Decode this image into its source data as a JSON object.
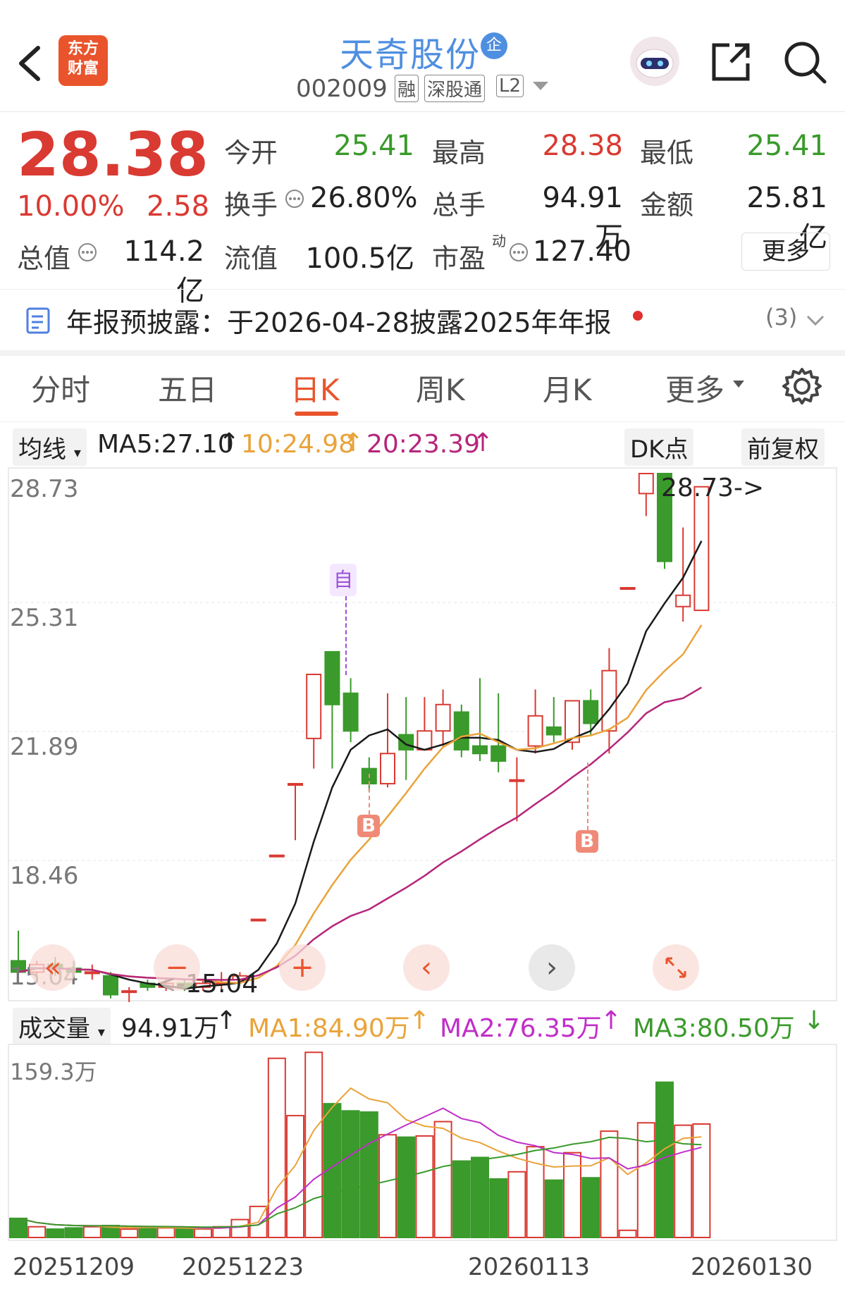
{
  "header": {
    "logo_line1": "东方",
    "logo_line2": "财富",
    "stock_name": "天奇股份",
    "name_badge": "企",
    "stock_code": "002009",
    "tag_margin": "融",
    "tag_connect": "深股通",
    "tag_level": "L2"
  },
  "quote": {
    "price": "28.38",
    "change_pct": "10.00%",
    "change_amt": "2.58",
    "open_label": "今开",
    "open_value": "25.41",
    "high_label": "最高",
    "high_value": "28.38",
    "low_label": "最低",
    "low_value": "25.41",
    "turnover_label": "换手",
    "turnover_value": "26.80%",
    "volume_label": "总手",
    "volume_value": "94.91万",
    "amount_label": "金额",
    "amount_value": "25.81亿",
    "mktcap_label": "总值",
    "mktcap_value": "114.2亿",
    "float_label": "流值",
    "float_value": "100.5亿",
    "pe_label": "市盈",
    "pe_super": "动",
    "pe_value": "127.40",
    "more_button": "更多"
  },
  "notice": {
    "text": "年报预披露：于2026-04-28披露2025年年报",
    "count": "(3)"
  },
  "tabs": [
    "分时",
    "五日",
    "日K",
    "周K",
    "月K",
    "更多"
  ],
  "active_tab": "日K",
  "ma_bar": {
    "selector": "均线",
    "ma5": "MA5:27.10",
    "ma10": "10:24.98",
    "ma20": "20:23.39",
    "dk_button": "DK点",
    "adjust_button": "前复权"
  },
  "price_axis": [
    "28.73",
    "25.31",
    "21.89",
    "18.46",
    "15.04"
  ],
  "annotations": {
    "high_marker": "28.73->",
    "low_marker": "<-15.04",
    "self_tag": "自",
    "buy_tag": "B"
  },
  "volume_bar": {
    "selector": "成交量",
    "vol": "94.91万",
    "ma1": "MA1:84.90万",
    "ma2": "MA2:76.35万",
    "ma3": "MA3:80.50万",
    "axis_top": "159.3万"
  },
  "dates": [
    "20251209",
    "20251223",
    "20260113",
    "20260130"
  ],
  "colors": {
    "up": "#d93a32",
    "down": "#3a9a2b",
    "ma5": "#1a1a1a",
    "ma10": "#e9a33a",
    "ma20": "#b5267b",
    "accent": "#e9542c"
  },
  "chart_data": {
    "type": "candlestick",
    "ylim": [
      15.04,
      28.73
    ],
    "candles": [
      {
        "o": 15.8,
        "c": 15.5,
        "h": 16.6,
        "l": 15.3
      },
      {
        "o": 15.5,
        "c": 15.7,
        "h": 15.8,
        "l": 15.4
      },
      {
        "o": 15.7,
        "c": 15.6,
        "h": 15.9,
        "l": 15.4
      },
      {
        "o": 15.6,
        "c": 15.5,
        "h": 15.8,
        "l": 15.4
      },
      {
        "o": 15.5,
        "c": 15.5,
        "h": 15.7,
        "l": 15.3
      },
      {
        "o": 15.4,
        "c": 14.9,
        "h": 15.5,
        "l": 14.8
      },
      {
        "o": 15.0,
        "c": 15.0,
        "h": 15.1,
        "l": 14.6
      },
      {
        "o": 15.2,
        "c": 15.1,
        "h": 15.3,
        "l": 15.0
      },
      {
        "o": 15.1,
        "c": 15.2,
        "h": 15.3,
        "l": 15.0
      },
      {
        "o": 15.2,
        "c": 15.1,
        "h": 15.3,
        "l": 15.0
      },
      {
        "o": 15.1,
        "c": 15.2,
        "h": 15.3,
        "l": 15.0
      },
      {
        "o": 15.2,
        "c": 15.2,
        "h": 15.5,
        "l": 15.0
      },
      {
        "o": 15.3,
        "c": 15.4,
        "h": 15.5,
        "l": 15.2
      },
      {
        "o": 16.9,
        "c": 16.9,
        "h": 16.9,
        "l": 16.9
      },
      {
        "o": 18.6,
        "c": 18.6,
        "h": 18.6,
        "l": 18.6
      },
      {
        "o": 20.5,
        "c": 20.5,
        "h": 20.5,
        "l": 19.0
      },
      {
        "o": 21.7,
        "c": 23.4,
        "h": 23.4,
        "l": 20.9
      },
      {
        "o": 24.0,
        "c": 22.6,
        "h": 24.0,
        "l": 20.9
      },
      {
        "o": 22.9,
        "c": 21.9,
        "h": 23.3,
        "l": 21.6
      },
      {
        "o": 20.9,
        "c": 20.5,
        "h": 21.2,
        "l": 20.3
      },
      {
        "o": 20.5,
        "c": 21.3,
        "h": 22.9,
        "l": 20.4
      },
      {
        "o": 21.8,
        "c": 21.4,
        "h": 22.8,
        "l": 20.6
      },
      {
        "o": 21.4,
        "c": 21.9,
        "h": 22.8,
        "l": 21.4
      },
      {
        "o": 21.9,
        "c": 22.6,
        "h": 23.0,
        "l": 21.5
      },
      {
        "o": 22.4,
        "c": 21.4,
        "h": 22.6,
        "l": 21.2
      },
      {
        "o": 21.5,
        "c": 21.3,
        "h": 23.3,
        "l": 21.1
      },
      {
        "o": 21.5,
        "c": 21.1,
        "h": 22.9,
        "l": 20.8
      },
      {
        "o": 20.6,
        "c": 20.6,
        "h": 21.2,
        "l": 19.5
      },
      {
        "o": 21.5,
        "c": 22.3,
        "h": 23.0,
        "l": 21.3
      },
      {
        "o": 22.0,
        "c": 21.8,
        "h": 22.8,
        "l": 21.6
      },
      {
        "o": 21.6,
        "c": 22.7,
        "h": 22.7,
        "l": 21.4
      },
      {
        "o": 22.7,
        "c": 22.1,
        "h": 23.0,
        "l": 21.8
      },
      {
        "o": 21.9,
        "c": 23.5,
        "h": 24.1,
        "l": 21.3
      },
      {
        "o": 25.7,
        "c": 25.7,
        "h": 25.7,
        "l": 25.7
      },
      {
        "o": 28.2,
        "c": 28.73,
        "h": 28.73,
        "l": 27.6
      },
      {
        "o": 28.73,
        "c": 26.4,
        "h": 28.73,
        "l": 26.2
      },
      {
        "o": 25.2,
        "c": 25.5,
        "h": 27.3,
        "l": 24.8
      },
      {
        "o": 25.1,
        "c": 28.38,
        "h": 28.38,
        "l": 25.1
      }
    ],
    "volumes": [
      0.16,
      0.09,
      0.07,
      0.08,
      0.09,
      0.1,
      0.07,
      0.08,
      0.08,
      0.07,
      0.07,
      0.09,
      0.15,
      0.26,
      1.5,
      1.02,
      1.55,
      1.12,
      1.06,
      1.05,
      0.86,
      0.84,
      0.85,
      0.97,
      0.64,
      0.67,
      0.49,
      0.55,
      0.76,
      0.48,
      0.71,
      0.5,
      0.89,
      0.06,
      0.96,
      1.3,
      0.94,
      0.95
    ],
    "volume_ylim": [
      0,
      159.3
    ]
  }
}
